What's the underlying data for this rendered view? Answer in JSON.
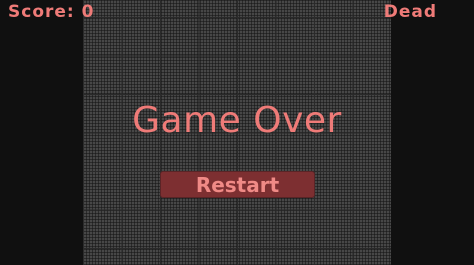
{
  "hud": {
    "score_label": "Score: 0",
    "status": "Dead"
  },
  "game_over": {
    "title": "Game Over",
    "restart_label": "Restart"
  },
  "colors": {
    "accent_text": "#ef7b78",
    "button_bg": "#7d2f31",
    "board": "#474747",
    "background": "#101010"
  }
}
